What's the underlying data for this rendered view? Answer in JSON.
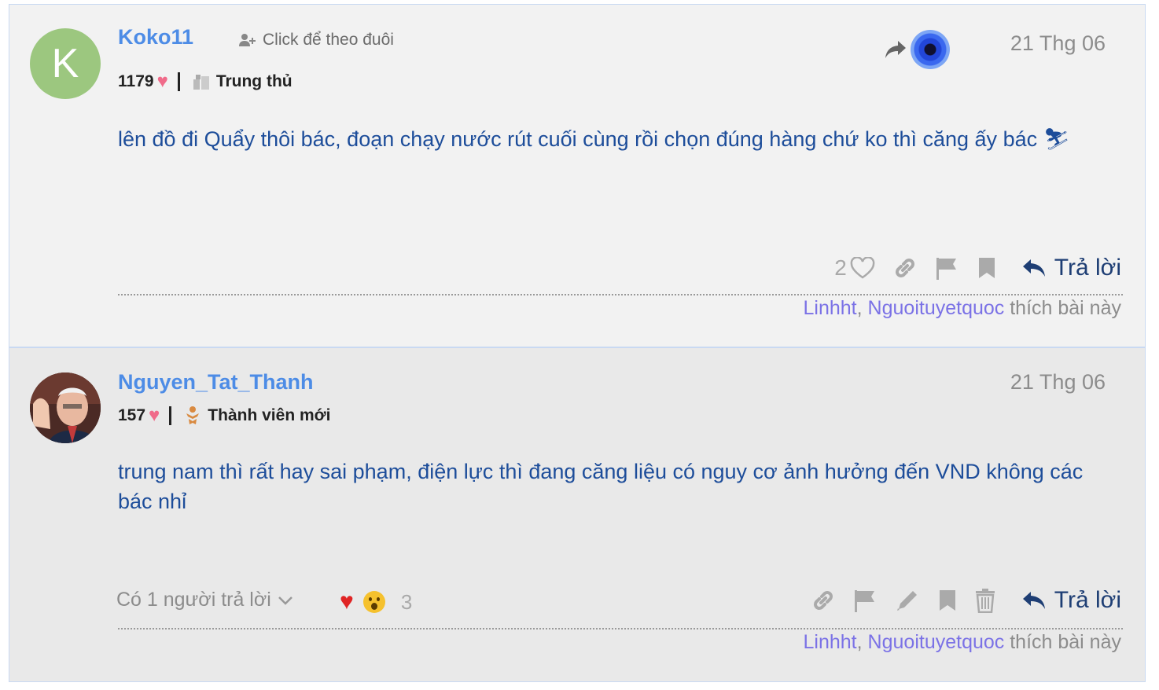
{
  "posts": [
    {
      "username": "Koko11",
      "avatar_letter": "K",
      "follow_label": "Click để theo đuôi",
      "likes_received": "1179",
      "rank": "Trung thủ",
      "date": "21 Thg 06",
      "content": "lên đồ đi Quẩy thôi bác, đoạn chạy nước rút cuối cùng rồi chọn đúng hàng chứ ko thì căng ấy bác",
      "emoji": "⛷",
      "like_count": "2",
      "reply_label": "Trả lời",
      "liked_by": [
        "Linhht",
        "Nguoituyetquoc"
      ],
      "liked_suffix": "thích bài này"
    },
    {
      "username": "Nguyen_Tat_Thanh",
      "likes_received": "157",
      "rank": "Thành viên mới",
      "date": "21 Thg 06",
      "content": "trung nam thì rất hay sai phạm, điện lực thì đang căng liệu có nguy cơ ảnh hưởng đến VND không các bác nhỉ",
      "replies_label": "Có 1 người trả lời",
      "reaction_count": "3",
      "reply_label": "Trả lời",
      "liked_by": [
        "Linhht",
        "Nguoituyetquoc"
      ],
      "liked_suffix": "thích bài này"
    }
  ],
  "icons": {
    "heart": "heart-icon",
    "follow": "user-plus-icon",
    "share": "share-arrow-icon",
    "link": "link-icon",
    "flag": "flag-icon",
    "bookmark": "bookmark-icon",
    "edit": "pencil-icon",
    "delete": "trash-icon",
    "reply": "reply-arrow-icon"
  },
  "colors": {
    "username": "#4d8ce6",
    "content": "#1d4d9a",
    "liker": "#7b72e6",
    "reply": "#1e3e74"
  }
}
